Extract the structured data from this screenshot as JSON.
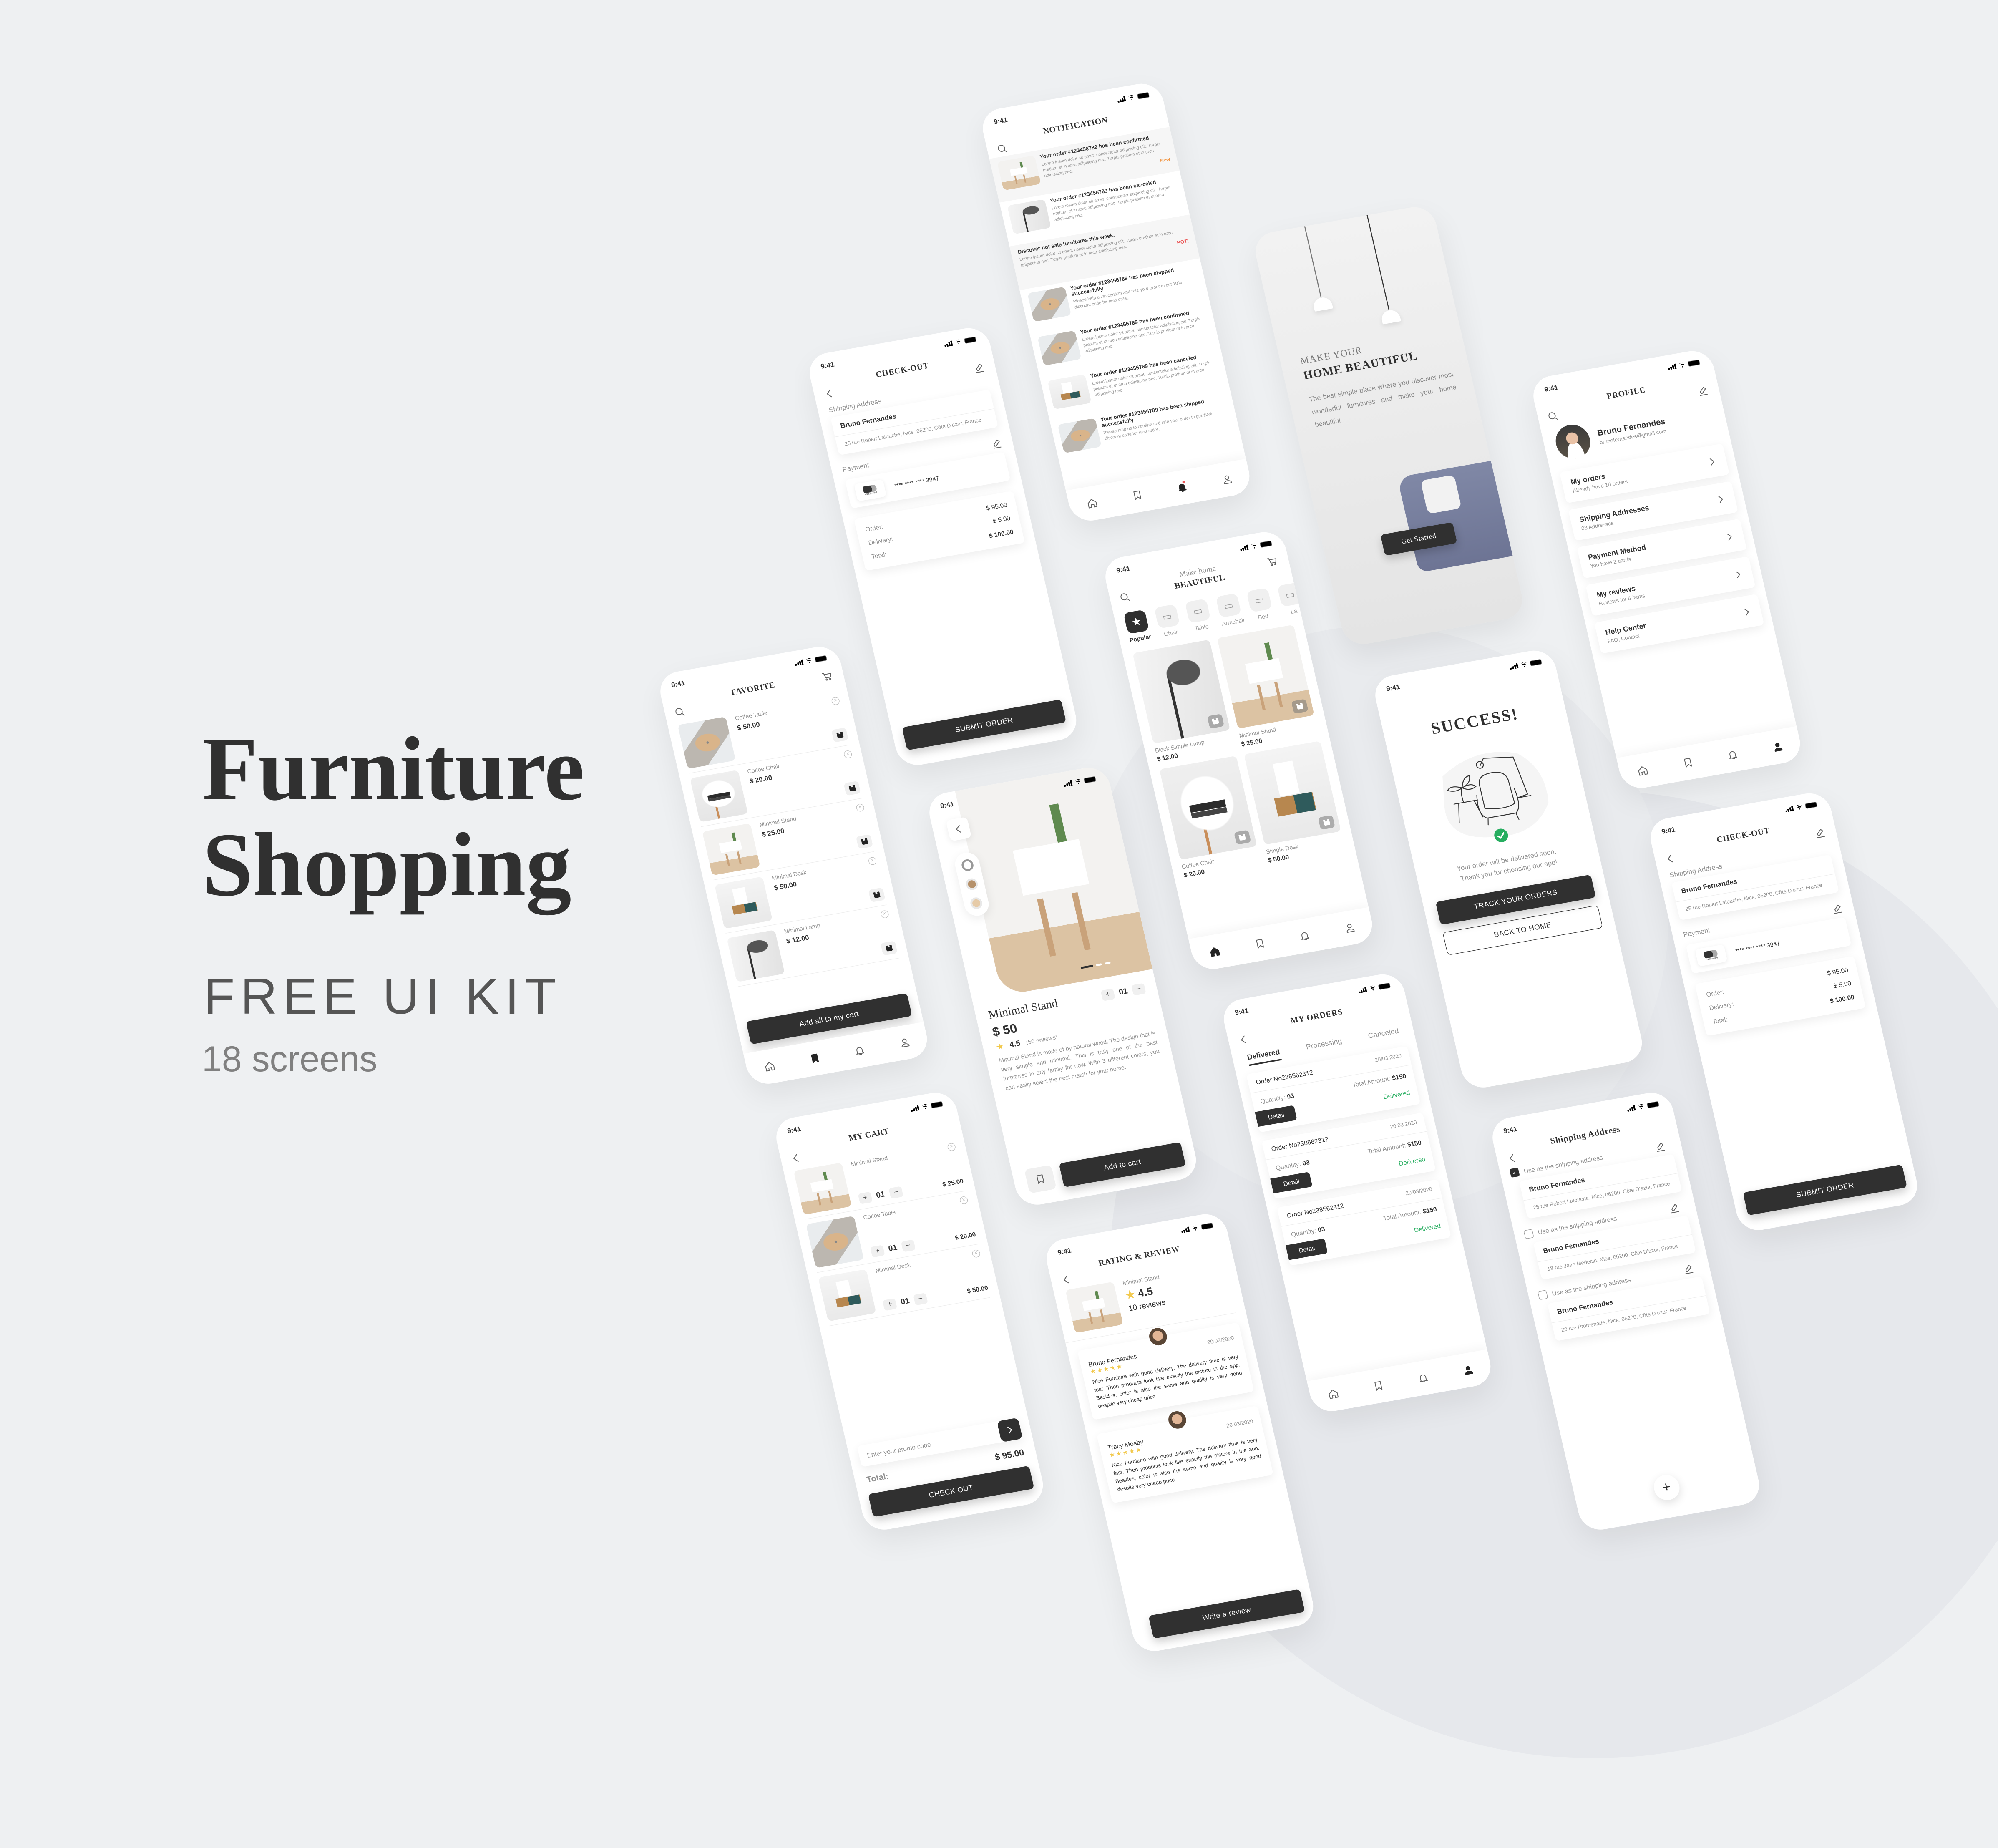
{
  "colors": {
    "dark": "#303030",
    "green": "#27ae60",
    "new": "#f2994a",
    "hot": "#eb5757",
    "star": "#f2c94c",
    "background": "#eef0f2"
  },
  "cover": {
    "title_line1": "Furniture",
    "title_line2": "Shopping",
    "subtitle": "FREE UI KIT",
    "screens_count": "18 screens"
  },
  "status_time": "9:41",
  "notification": {
    "title": "NOTIFICATION",
    "items": [
      {
        "title": "Your order #123456789 has been confirmed",
        "body": "Lorem ipsum dolor sit amet, consectetur adipiscing elit. Turpis pretium et in arcu adipiscing nec. Turpis pretium et in arcu adipiscing nec.",
        "badge": "New",
        "img": "stand"
      },
      {
        "title": "Your order #123456789 has been canceled",
        "body": "Lorem ipsum dolor sit amet, consectetur adipiscing elit. Turpis pretium et in arcu adipiscing nec. Turpis pretium et in arcu adipiscing nec.",
        "img": "lamp"
      },
      {
        "title": "Discover hot sale furnitures this week.",
        "body": "Lorem ipsum dolor sit amet, consectetur adipiscing elit. Turpis pretium et in arcu adipiscing nec. Turpis pretium et in arcu adipiscing nec.",
        "badge": "HOT!"
      },
      {
        "title": "Your order #123456789 has been shipped successfully",
        "body": "Please help us to confirm and rate your order to get 10% discount code for next order.",
        "img": "table"
      },
      {
        "title": "Your order #123456789 has been confirmed",
        "body": "Lorem ipsum dolor sit amet, consectetur adipiscing elit. Turpis pretium et in arcu adipiscing nec. Turpis pretium et in arcu adipiscing nec.",
        "img": "table"
      },
      {
        "title": "Your order #123456789 has been canceled",
        "body": "Lorem ipsum dolor sit amet, consectetur adipiscing elit. Turpis pretium et in arcu adipiscing nec. Turpis pretium et in arcu adipiscing nec.",
        "img": "desk"
      },
      {
        "title": "Your order #123456789 has been shipped successfully",
        "body": "Please help us to confirm and rate your order to get 10% discount code for next order.",
        "img": "table"
      }
    ]
  },
  "checkout": {
    "title": "CHECK-OUT",
    "shipping_label": "Shipping Address",
    "name": "Bruno Fernandes",
    "address": "25 rue Robert Latouche, Nice, 06200, Côte D’azur, France",
    "payment_label": "Payment",
    "card_brand": "mastercard",
    "card_number": "**** **** **** 3947",
    "order_label": "Order:",
    "order_value": "$ 95.00",
    "delivery_label": "Delivery:",
    "delivery_value": "$ 5.00",
    "total_label": "Total:",
    "total_value": "$ 100.00",
    "submit": "SUBMIT ORDER"
  },
  "onboarding": {
    "line1": "MAKE YOUR",
    "line2": "HOME BEAUTIFUL",
    "text": "The best simple place where you discover most wonderful furnitures and make your home beautiful",
    "button": "Get Started"
  },
  "profile": {
    "title": "PROFILE",
    "name": "Bruno Fernandes",
    "email": "brunofernandes@gmail.com",
    "items": [
      {
        "label": "My orders",
        "sub": "Already have 10 orders"
      },
      {
        "label": "Shipping Addresses",
        "sub": "03 Addresses"
      },
      {
        "label": "Payment Method",
        "sub": "You have 2 cards"
      },
      {
        "label": "My reviews",
        "sub": "Reviews for 5 items"
      },
      {
        "label": "Help Center",
        "sub": "FAQ, Contact"
      }
    ]
  },
  "favorite": {
    "title": "FAVORITE",
    "items": [
      {
        "name": "Coffee Table",
        "price": "$ 50.00",
        "img": "table"
      },
      {
        "name": "Coffee Chair",
        "price": "$ 20.00",
        "img": "chair"
      },
      {
        "name": "Minimal Stand",
        "price": "$ 25.00",
        "img": "stand"
      },
      {
        "name": "Minimal Desk",
        "price": "$ 50.00",
        "img": "desk"
      },
      {
        "name": "Minimal Lamp",
        "price": "$ 12.00",
        "img": "lamp"
      }
    ],
    "button": "Add all to my cart"
  },
  "home": {
    "title_top": "Make home",
    "title_bottom": "BEAUTIFUL",
    "categories": [
      {
        "label": "Popular"
      },
      {
        "label": "Chair"
      },
      {
        "label": "Table"
      },
      {
        "label": "Armchair"
      },
      {
        "label": "Bed"
      },
      {
        "label": "La"
      }
    ],
    "products": [
      {
        "name": "Black Simple Lamp",
        "price": "$ 12.00",
        "img": "lamp"
      },
      {
        "name": "Minimal Stand",
        "price": "$ 25.00",
        "img": "stand"
      },
      {
        "name": "Coffee Chair",
        "price": "$ 20.00",
        "img": "chair"
      },
      {
        "name": "Simple Desk",
        "price": "$ 50.00",
        "img": "desk"
      }
    ]
  },
  "product": {
    "name": "Minimal Stand",
    "price": "$ 50",
    "quantity": "01",
    "rating": "4.5",
    "reviews": "(50 reviews)",
    "description": "Minimal Stand is made of by natural wood. The design that is very simple and minimal. This is truly one of the best furnitures in any family for now. With 3 different colors, you can easily select the best match for your home.",
    "button": "Add to cart",
    "colors": [
      "#ffffff",
      "#b5916b",
      "#e6cba8"
    ]
  },
  "success": {
    "title": "SUCCESS!",
    "message_line1": "Your order will be delivered soon.",
    "message_line2": "Thank you for choosing our app!",
    "primary_button": "TRACK YOUR ORDERS",
    "secondary_button": "BACK TO HOME"
  },
  "cart": {
    "title": "MY CART",
    "items": [
      {
        "name": "Minimal Stand",
        "quantity": "01",
        "price": "$ 25.00",
        "img": "stand"
      },
      {
        "name": "Coffee Table",
        "quantity": "01",
        "price": "$ 20.00",
        "img": "table"
      },
      {
        "name": "Minimal Desk",
        "quantity": "01",
        "price": "$ 50.00",
        "img": "desk"
      }
    ],
    "promo_placeholder": "Enter your promo code",
    "total_label": "Total:",
    "total_value": "$ 95.00",
    "button": "CHECK OUT"
  },
  "orders": {
    "title": "MY ORDERS",
    "tabs": [
      "Delivered",
      "Processing",
      "Canceled"
    ],
    "items": [
      {
        "number": "Order No238562312",
        "date": "20/03/2020",
        "quantity_label": "Quantity:",
        "quantity": "03",
        "amount_label": "Total Amount:",
        "amount": "$150",
        "status": "Delivered",
        "button": "Detail"
      },
      {
        "number": "Order No238562312",
        "date": "20/03/2020",
        "quantity_label": "Quantity:",
        "quantity": "03",
        "amount_label": "Total Amount:",
        "amount": "$150",
        "status": "Delivered",
        "button": "Detail"
      },
      {
        "number": "Order No238562312",
        "date": "20/03/2020",
        "quantity_label": "Quantity:",
        "quantity": "03",
        "amount_label": "Total Amount:",
        "amount": "$150",
        "status": "Delivered",
        "button": "Detail"
      }
    ]
  },
  "rating": {
    "title": "RATING & REVIEW",
    "product": "Minimal Stand",
    "score": "4.5",
    "count": "10 reviews",
    "reviews": [
      {
        "name": "Bruno Fernandes",
        "date": "20/03/2020",
        "stars": 5,
        "text": "Nice Furniture with good delivery. The delivery time is very fast. Then products look like exactly the picture in the app. Besides, color is also the same and quality is very good despite very cheap price"
      },
      {
        "name": "Tracy Mosby",
        "date": "20/03/2020",
        "stars": 5,
        "text": "Nice Furniture with good delivery. The delivery time is very fast. Then products look like exactly the picture in the app. Besides, color is also the same and quality is very good despite very cheap price"
      }
    ],
    "button": "Write a review"
  },
  "shipping": {
    "title": "Shipping Address",
    "use_label": "Use as the shipping address",
    "addresses": [
      {
        "name": "Bruno Fernandes",
        "address": "25 rue Robert Latouche, Nice, 06200, Côte D’azur, France",
        "checked": true
      },
      {
        "name": "Bruno Fernandes",
        "address": "18 rue Jean Medecin, Nice, 06200, Côte D’azur, France",
        "checked": false
      },
      {
        "name": "Bruno Fernandes",
        "address": "20 rue Promenade, Nice, 06200, Côte D’azur, France",
        "checked": false
      }
    ]
  }
}
